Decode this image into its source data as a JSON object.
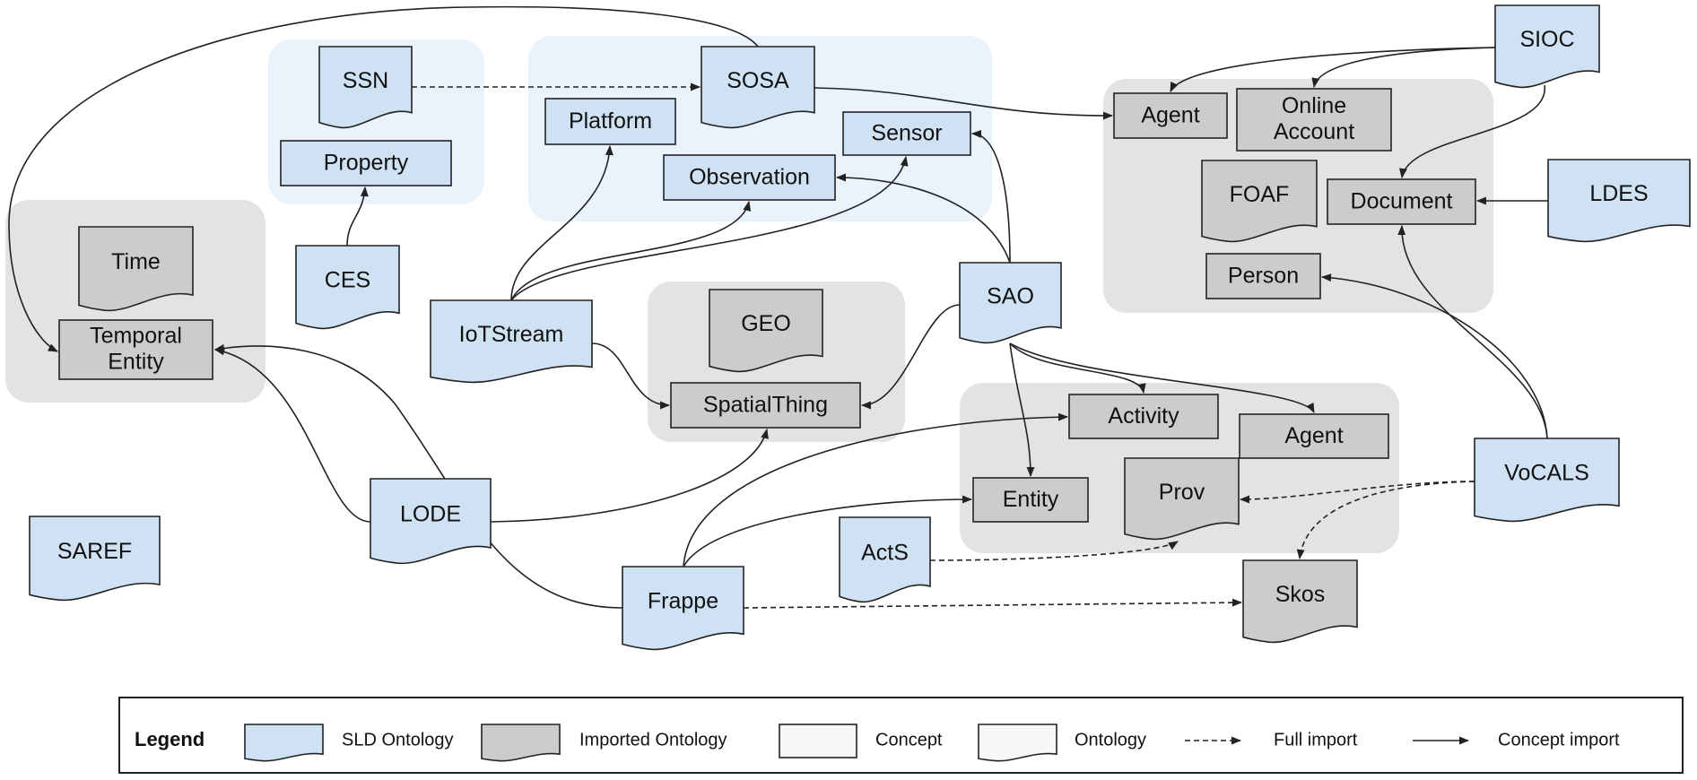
{
  "colors": {
    "sld": "#cfe2f3",
    "imported": "#cccccc",
    "group_sld": "#eaf2fb",
    "group_imported": "#e3e3e3",
    "plain": "#f7f7f7",
    "stroke": "#222222"
  },
  "groups": [
    {
      "id": "g-time",
      "kind": "imported"
    },
    {
      "id": "g-ssn",
      "kind": "sld"
    },
    {
      "id": "g-sosa",
      "kind": "sld"
    },
    {
      "id": "g-foaf",
      "kind": "imported"
    },
    {
      "id": "g-geo",
      "kind": "imported"
    },
    {
      "id": "g-prov",
      "kind": "imported"
    }
  ],
  "nodes": [
    {
      "id": "ssn",
      "label": "SSN",
      "shape": "ontology",
      "kind": "sld"
    },
    {
      "id": "sosa",
      "label": "SOSA",
      "shape": "ontology",
      "kind": "sld"
    },
    {
      "id": "property",
      "label": "Property",
      "shape": "concept",
      "kind": "sld"
    },
    {
      "id": "platform",
      "label": "Platform",
      "shape": "concept",
      "kind": "sld"
    },
    {
      "id": "sensor",
      "label": "Sensor",
      "shape": "concept",
      "kind": "sld"
    },
    {
      "id": "observation",
      "label": "Observation",
      "shape": "concept",
      "kind": "sld"
    },
    {
      "id": "time",
      "label": "Time",
      "shape": "ontology",
      "kind": "imported"
    },
    {
      "id": "temporal-entity",
      "label": "Temporal\nEntity",
      "shape": "concept",
      "kind": "imported"
    },
    {
      "id": "ces",
      "label": "CES",
      "shape": "ontology",
      "kind": "sld"
    },
    {
      "id": "iotstream",
      "label": "IoTStream",
      "shape": "ontology",
      "kind": "sld"
    },
    {
      "id": "geo",
      "label": "GEO",
      "shape": "ontology",
      "kind": "imported"
    },
    {
      "id": "spatialthing",
      "label": "SpatialThing",
      "shape": "concept",
      "kind": "imported"
    },
    {
      "id": "sao",
      "label": "SAO",
      "shape": "ontology",
      "kind": "sld"
    },
    {
      "id": "agent-foaf",
      "label": "Agent",
      "shape": "concept",
      "kind": "imported"
    },
    {
      "id": "online-account",
      "label": "Online\nAccount",
      "shape": "concept",
      "kind": "imported"
    },
    {
      "id": "foaf",
      "label": "FOAF",
      "shape": "ontology",
      "kind": "imported"
    },
    {
      "id": "document",
      "label": "Document",
      "shape": "concept",
      "kind": "imported"
    },
    {
      "id": "person",
      "label": "Person",
      "shape": "concept",
      "kind": "imported"
    },
    {
      "id": "sioc",
      "label": "SIOC",
      "shape": "ontology",
      "kind": "sld"
    },
    {
      "id": "ldes",
      "label": "LDES",
      "shape": "ontology",
      "kind": "sld"
    },
    {
      "id": "activity",
      "label": "Activity",
      "shape": "concept",
      "kind": "imported"
    },
    {
      "id": "agent-prov",
      "label": "Agent",
      "shape": "concept",
      "kind": "imported"
    },
    {
      "id": "entity",
      "label": "Entity",
      "shape": "concept",
      "kind": "imported"
    },
    {
      "id": "prov",
      "label": "Prov",
      "shape": "ontology",
      "kind": "imported"
    },
    {
      "id": "vocals",
      "label": "VoCALS",
      "shape": "ontology",
      "kind": "sld"
    },
    {
      "id": "acts",
      "label": "ActS",
      "shape": "ontology",
      "kind": "sld"
    },
    {
      "id": "skos",
      "label": "Skos",
      "shape": "ontology",
      "kind": "imported"
    },
    {
      "id": "lode",
      "label": "LODE",
      "shape": "ontology",
      "kind": "sld"
    },
    {
      "id": "saref",
      "label": "SAREF",
      "shape": "ontology",
      "kind": "sld"
    },
    {
      "id": "frappe",
      "label": "Frappe",
      "shape": "ontology",
      "kind": "sld"
    }
  ],
  "edges": [
    {
      "from": "ssn",
      "to": "sosa",
      "type": "full"
    },
    {
      "from": "sosa",
      "to": "agent-foaf",
      "type": "concept"
    },
    {
      "from": "sosa",
      "to": "temporal-entity",
      "type": "concept"
    },
    {
      "from": "ces",
      "to": "property",
      "type": "concept"
    },
    {
      "from": "iotstream",
      "to": "platform",
      "type": "concept"
    },
    {
      "from": "iotstream",
      "to": "observation",
      "type": "concept"
    },
    {
      "from": "iotstream",
      "to": "sensor",
      "type": "concept"
    },
    {
      "from": "iotstream",
      "to": "spatialthing",
      "type": "concept"
    },
    {
      "from": "sao",
      "to": "sensor",
      "type": "concept"
    },
    {
      "from": "sao",
      "to": "observation",
      "type": "concept"
    },
    {
      "from": "sao",
      "to": "spatialthing",
      "type": "concept"
    },
    {
      "from": "sao",
      "to": "entity",
      "type": "concept"
    },
    {
      "from": "sao",
      "to": "activity",
      "type": "concept"
    },
    {
      "from": "sao",
      "to": "agent-prov",
      "type": "concept"
    },
    {
      "from": "sioc",
      "to": "agent-foaf",
      "type": "concept"
    },
    {
      "from": "sioc",
      "to": "online-account",
      "type": "concept"
    },
    {
      "from": "sioc",
      "to": "document",
      "type": "concept"
    },
    {
      "from": "ldes",
      "to": "document",
      "type": "concept"
    },
    {
      "from": "vocals",
      "to": "person",
      "type": "concept"
    },
    {
      "from": "vocals",
      "to": "document",
      "type": "concept"
    },
    {
      "from": "vocals",
      "to": "prov",
      "type": "full"
    },
    {
      "from": "vocals",
      "to": "skos",
      "type": "full"
    },
    {
      "from": "acts",
      "to": "prov",
      "type": "full"
    },
    {
      "from": "lode",
      "to": "temporal-entity",
      "type": "concept"
    },
    {
      "from": "lode",
      "to": "spatialthing",
      "type": "concept"
    },
    {
      "from": "frappe",
      "to": "temporal-entity",
      "type": "concept"
    },
    {
      "from": "frappe",
      "to": "activity",
      "type": "concept"
    },
    {
      "from": "frappe",
      "to": "entity",
      "type": "concept"
    },
    {
      "from": "frappe",
      "to": "skos",
      "type": "full"
    }
  ],
  "legend": {
    "title": "Legend",
    "items": [
      {
        "label": "SLD Ontology",
        "symbol": "ontology",
        "kind": "sld"
      },
      {
        "label": "Imported Ontology",
        "symbol": "ontology",
        "kind": "imported"
      },
      {
        "label": "Concept",
        "symbol": "concept",
        "kind": "plain"
      },
      {
        "label": "Ontology",
        "symbol": "ontology",
        "kind": "plain"
      },
      {
        "label": "Full import",
        "symbol": "dashed-arrow"
      },
      {
        "label": "Concept import",
        "symbol": "solid-arrow"
      }
    ]
  }
}
